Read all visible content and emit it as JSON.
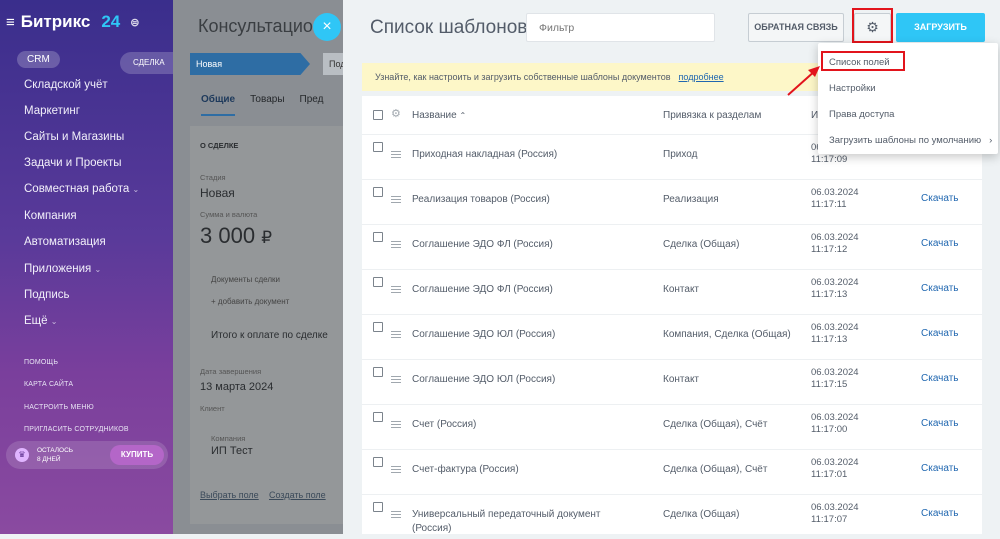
{
  "sidebar": {
    "logo": {
      "brand": "Битрикс",
      "number": "24"
    },
    "crm_pill": "CRM",
    "deal_pill": "СДЕЛКА",
    "items": [
      "Складской учёт",
      "Маркетинг",
      "Сайты и Магазины",
      "Задачи и Проекты",
      "Совместная работа",
      "Компания",
      "Автоматизация",
      "Приложения",
      "Подпись",
      "Ещё"
    ],
    "small_items": [
      "ПОМОЩЬ",
      "КАРТА САЙТА",
      "НАСТРОИТЬ МЕНЮ",
      "ПРИГЛАСИТЬ СОТРУДНИКОВ"
    ],
    "trial": {
      "line1": "ОСТАЛОСЬ",
      "line2": "8 ДНЕЙ",
      "buy": "КУПИТЬ"
    }
  },
  "deal": {
    "title": "Консультацион",
    "stage_current": "Новая",
    "stage_next": "Под",
    "tabs": [
      "Общие",
      "Товары",
      "Пред"
    ],
    "section_title": "О СДЕЛКЕ",
    "stage_label": "Стадия",
    "stage_value": "Новая",
    "amount_label": "Сумма и валюта",
    "amount_value": "3 000",
    "currency": "₽",
    "docs_label": "Документы сделки",
    "add_doc": "+ добавить документ",
    "total_label": "Итого к оплате по сделке",
    "close_label": "Дата завершения",
    "close_value": "13 марта 2024",
    "client_label": "Клиент",
    "company_label": "Компания",
    "company_value": "ИП Тест",
    "choose_field": "Выбрать поле",
    "create_field": "Создать поле"
  },
  "panel": {
    "title": "Список шаблонов",
    "filter_placeholder": "Фильтр",
    "feedback_button": "ОБРАТНАЯ СВЯЗЬ",
    "upload_button": "ЗАГРУЗИТЬ",
    "notice_text": "Узнайте, как настроить и загрузить собственные шаблоны документов",
    "notice_link": "подробнее",
    "columns": {
      "name": "Название",
      "section": "Привязка к разделам",
      "date": "И"
    },
    "rows": [
      {
        "name": "Приходная накладная (Россия)",
        "section": "Приход",
        "date": "06.03.2024",
        "time": "11:17:09",
        "action": ""
      },
      {
        "name": "Реализация товаров (Россия)",
        "section": "Реализация",
        "date": "06.03.2024",
        "time": "11:17:11",
        "action": "Скачать"
      },
      {
        "name": "Соглашение ЭДО ФЛ (Россия)",
        "section": "Сделка (Общая)",
        "date": "06.03.2024",
        "time": "11:17:12",
        "action": "Скачать"
      },
      {
        "name": "Соглашение ЭДО ФЛ (Россия)",
        "section": "Контакт",
        "date": "06.03.2024",
        "time": "11:17:13",
        "action": "Скачать"
      },
      {
        "name": "Соглашение ЭДО ЮЛ (Россия)",
        "section": "Компания, Сделка (Общая)",
        "date": "06.03.2024",
        "time": "11:17:13",
        "action": "Скачать"
      },
      {
        "name": "Соглашение ЭДО ЮЛ (Россия)",
        "section": "Контакт",
        "date": "06.03.2024",
        "time": "11:17:15",
        "action": "Скачать"
      },
      {
        "name": "Счет (Россия)",
        "section": "Сделка (Общая), Счёт",
        "date": "06.03.2024",
        "time": "11:17:00",
        "action": "Скачать"
      },
      {
        "name": "Счет-фактура (Россия)",
        "section": "Сделка (Общая), Счёт",
        "date": "06.03.2024",
        "time": "11:17:01",
        "action": "Скачать"
      },
      {
        "name": "Универсальный передаточный документ (Россия)",
        "section": "Сделка (Общая)",
        "date": "06.03.2024",
        "time": "11:17:07",
        "action": "Скачать"
      }
    ]
  },
  "menu": {
    "items": [
      "Список полей",
      "Настройки",
      "Права доступа",
      "Загрузить шаблоны по умолчанию"
    ]
  },
  "colors": {
    "accent": "#2fc6f6",
    "highlight": "#e2141c",
    "link": "#2067b0"
  }
}
